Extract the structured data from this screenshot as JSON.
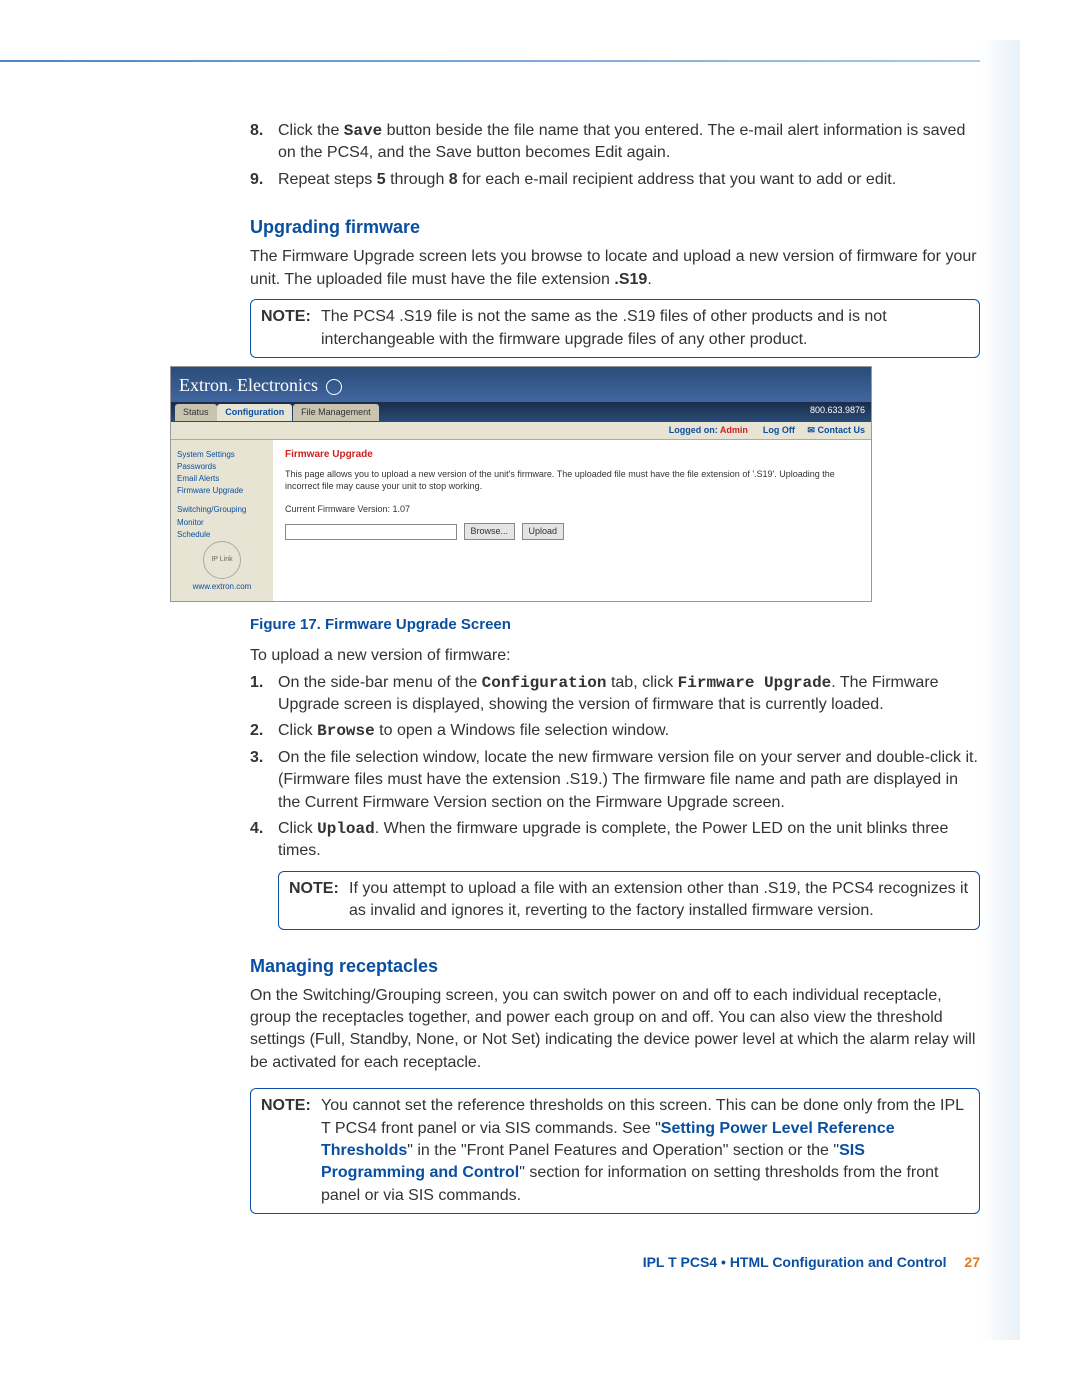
{
  "steps_top": [
    {
      "num": "8.",
      "pre": "Click the ",
      "mono": "Save",
      "post": " button beside the file name that you entered. The e-mail alert information is saved on the PCS4, and the Save button becomes Edit again."
    },
    {
      "num": "9.",
      "text_parts": [
        "Repeat steps ",
        "5",
        " through ",
        "8",
        " for each e-mail recipient address that you want to add or edit."
      ]
    }
  ],
  "section1_title": "Upgrading firmware",
  "section1_intro_parts": [
    "The Firmware Upgrade screen lets you browse to locate and upload a new version of firmware for your unit. The uploaded file must have the file extension ",
    ".S19",
    "."
  ],
  "note1": {
    "label": "NOTE:",
    "text": "The PCS4 .S19 file is not the same as the .S19 files of other products and is not interchangeable with the firmware upgrade files of any other product."
  },
  "screenshot": {
    "brand": "Extron. Electronics",
    "tabs": [
      "Status",
      "Configuration",
      "File Management"
    ],
    "active_tab": 1,
    "phone": "800.633.9876",
    "logged": "Logged on:",
    "admin": "Admin",
    "logoff": "Log Off",
    "contact": "Contact Us",
    "sidebar": [
      "System Settings",
      "Passwords",
      "Email Alerts",
      "Firmware Upgrade"
    ],
    "sidebar2": [
      "Switching/Grouping",
      "Monitor",
      "Schedule"
    ],
    "side_url": "www.extron.com",
    "main_heading": "Firmware Upgrade",
    "main_desc": "This page allows you to upload a new version of the unit's firmware. The uploaded file must have the file extension of '.S19'. Uploading the incorrect file may cause your unit to stop working.",
    "fw_version": "Current Firmware Version: 1.07",
    "browse": "Browse...",
    "upload": "Upload"
  },
  "fig_caption": "Figure 17. Firmware Upgrade Screen",
  "upload_intro": "To upload a new version of firmware:",
  "upload_steps": [
    {
      "num": "1.",
      "parts": [
        "On the side-bar menu of the ",
        {
          "mono": "Configuration"
        },
        " tab, click ",
        {
          "mono": "Firmware Upgrade"
        },
        ". The Firmware Upgrade screen is displayed, showing the version of firmware that is currently loaded."
      ]
    },
    {
      "num": "2.",
      "parts": [
        "Click ",
        {
          "mono": "Browse"
        },
        " to open a Windows file selection window."
      ]
    },
    {
      "num": "3.",
      "parts": [
        "On the file selection window, locate the new firmware version file on your server and double-click it. (Firmware files must have the extension .S19.) The firmware file name and path are displayed in the Current Firmware Version section on the Firmware Upgrade screen."
      ]
    },
    {
      "num": "4.",
      "parts": [
        "Click ",
        {
          "mono": "Upload"
        },
        ". When the firmware upgrade is complete, the Power LED on the unit blinks three times."
      ]
    }
  ],
  "note2": {
    "label": "NOTE:",
    "text": "If you attempt to upload a file with an extension other than .S19, the PCS4 recognizes it as invalid and ignores it, reverting to the factory installed firmware version."
  },
  "section2_title": "Managing receptacles",
  "section2_text": "On the Switching/Grouping screen, you can switch power on and off to each individual receptacle, group the receptacles together, and power each group on and off. You can also view the threshold settings (Full, Standby, None, or Not Set) indicating the device power level at which the alarm relay will be activated for each receptacle.",
  "note3": {
    "label": "NOTE:",
    "parts": [
      "You cannot set the reference thresholds on this screen. This can be done only from the IPL T PCS4 front panel or via SIS commands. See \"",
      {
        "link": "Setting Power Level Reference Thresholds"
      },
      "\" in the \"Front Panel Features and Operation\" section or the \"",
      {
        "link": "SIS Programming and Control"
      },
      "\" section for information on setting thresholds from the front panel or via SIS commands."
    ]
  },
  "footer": {
    "title": "IPL T PCS4 • HTML Configuration and Control",
    "page": "27"
  }
}
